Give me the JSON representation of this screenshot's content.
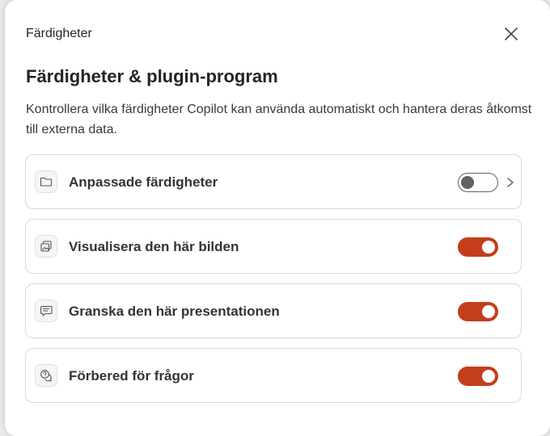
{
  "dialog": {
    "header_title": "Färdigheter",
    "title": "Färdigheter & plugin-program",
    "description": "Kontrollera vilka färdigheter Copilot kan använda automatiskt och hantera deras åtkomst till externa data.",
    "close_icon": "close-icon"
  },
  "skills": [
    {
      "label": "Anpassade färdigheter",
      "icon": "folder-icon",
      "enabled": false,
      "has_chevron": true
    },
    {
      "label": "Visualisera den här bilden",
      "icon": "image-icon",
      "enabled": true,
      "has_chevron": false
    },
    {
      "label": "Granska den här presentationen",
      "icon": "chat-review-icon",
      "enabled": true,
      "has_chevron": false
    },
    {
      "label": "Förbered för frågor",
      "icon": "chat-question-icon",
      "enabled": true,
      "has_chevron": false
    }
  ],
  "colors": {
    "toggle_on": "#c43e1c",
    "toggle_off_border": "#616161"
  }
}
